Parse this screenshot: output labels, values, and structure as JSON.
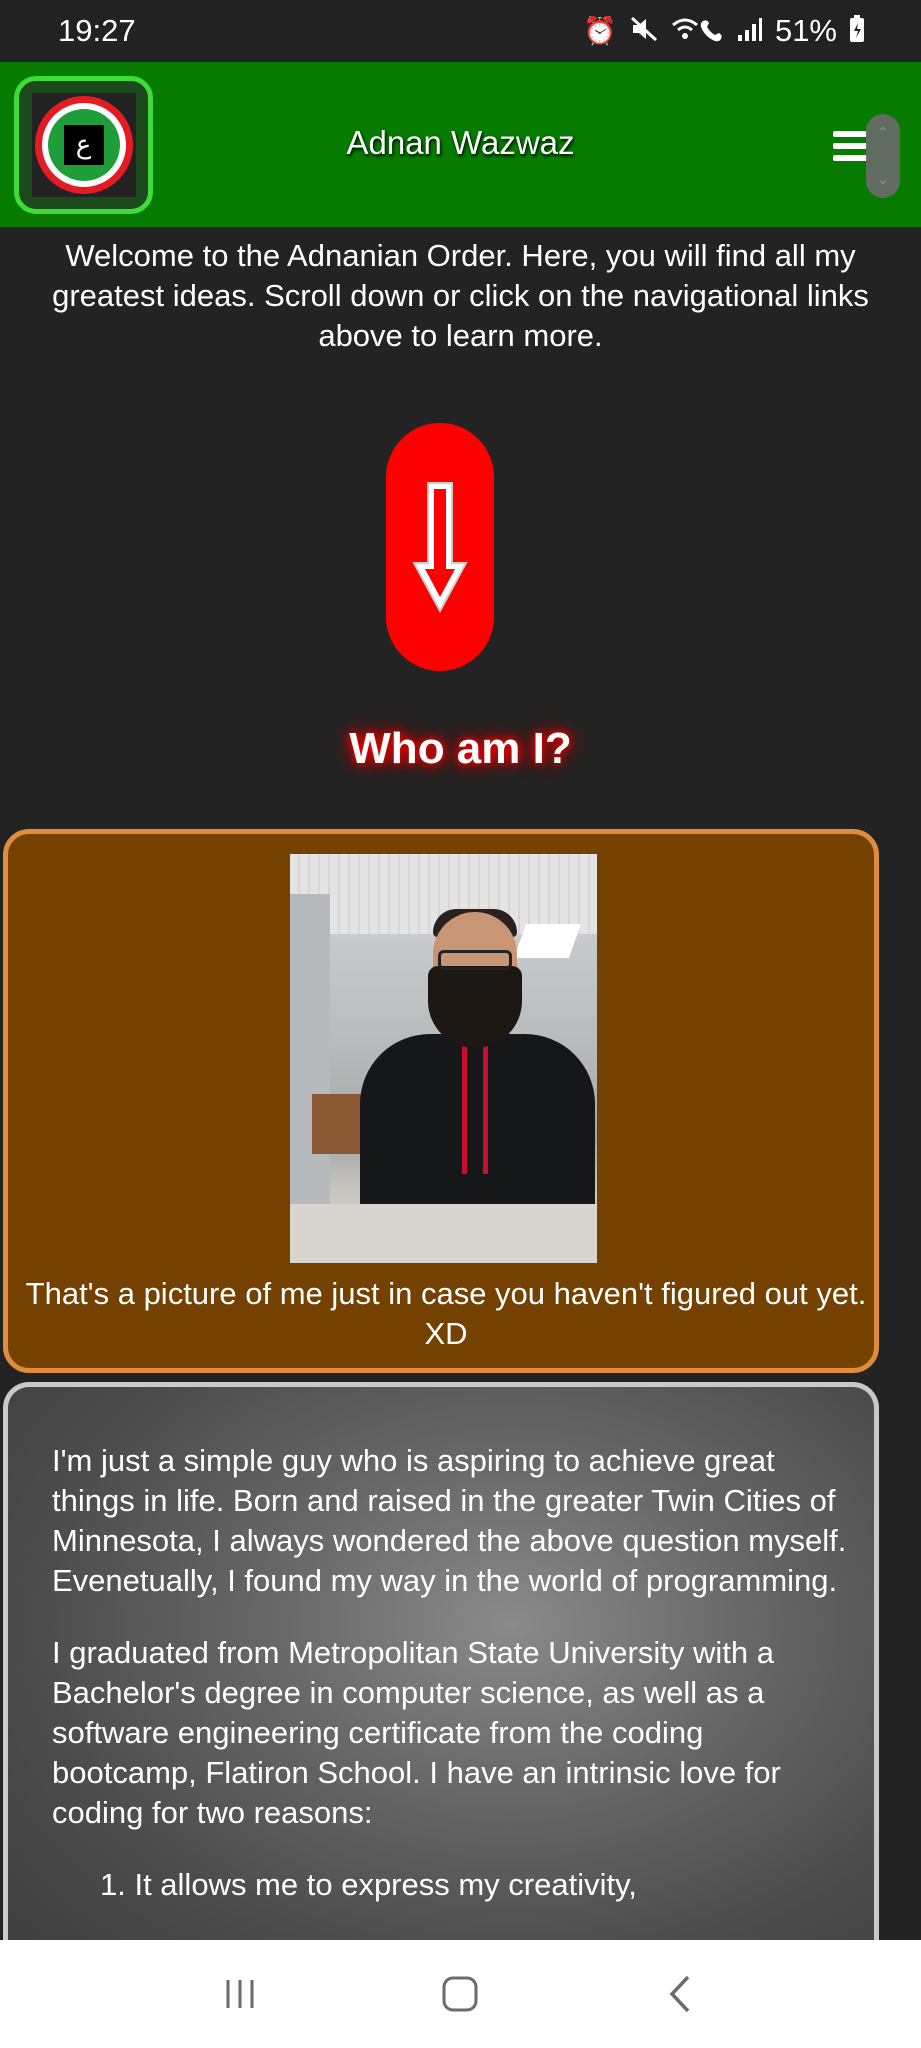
{
  "status_bar": {
    "time": "19:27",
    "battery": "51%",
    "icons": [
      "alarm-icon",
      "mute-icon",
      "wifi-calling-icon",
      "signal-icon",
      "battery-icon"
    ]
  },
  "header": {
    "title": "Adnan Wazwaz",
    "logo_glyph": "ع",
    "background_color": "#067b00",
    "menu_icon": "hamburger-menu-icon"
  },
  "intro": {
    "text": "Welcome to the Adnanian Order. Here, you will find all my greatest ideas. Scroll down or click on the navigational links above to learn more."
  },
  "scroll_button": {
    "icon": "down-arrow-icon",
    "color": "#ff0000"
  },
  "section": {
    "heading": "Who am I?"
  },
  "photo_card": {
    "caption": "That's a picture of me just in case you haven't figured out yet. XD",
    "background_color": "#744100",
    "border_color": "#e08c3d"
  },
  "bio": {
    "paragraph_1": "I'm just a simple guy who is aspiring to achieve great things in life. Born and raised in the greater Twin Cities of Minnesota, I always wondered the above question myself. Evenetually, I found my way in the world of programming.",
    "paragraph_2": "I graduated from Metropolitan State University with a Bachelor's degree in computer science, as well as a software engineering certificate from the coding bootcamp, Flatiron School. I have an intrinsic love for coding for two reasons:",
    "list_item_1": "1. It allows me to express my creativity,"
  },
  "nav_bar": {
    "recents": "recents-icon",
    "home": "home-icon",
    "back": "back-icon"
  }
}
